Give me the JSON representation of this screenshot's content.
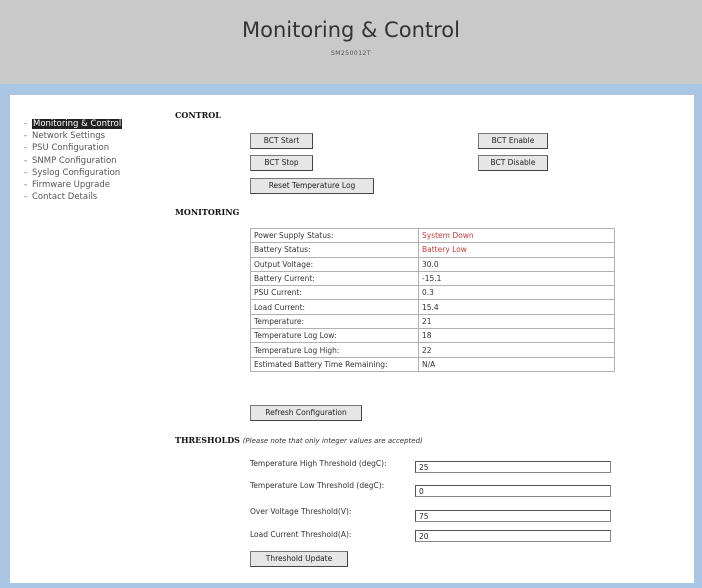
{
  "header": {
    "title": "Monitoring & Control",
    "subtitle": "SM250012T"
  },
  "nav": {
    "items": [
      {
        "label": "Monitoring & Control",
        "active": true
      },
      {
        "label": "Network Settings"
      },
      {
        "label": "PSU Configuration"
      },
      {
        "label": "SNMP Configuration"
      },
      {
        "label": "Syslog Configuration"
      },
      {
        "label": "Firmware Upgrade"
      },
      {
        "label": "Contact Details"
      }
    ]
  },
  "control": {
    "heading": "CONTROL",
    "bct_start": "BCT Start",
    "bct_stop": "BCT Stop",
    "bct_enable": "BCT Enable",
    "bct_disable": "BCT Disable",
    "reset_temp_log": "Reset Temperature Log"
  },
  "monitoring": {
    "heading": "MONITORING",
    "rows": [
      {
        "label": "Power Supply Status:",
        "value": "System Down",
        "alert": true
      },
      {
        "label": "Battery Status:",
        "value": "Battery Low",
        "alert": true
      },
      {
        "label": "Output Voltage:",
        "value": "30.0"
      },
      {
        "label": "Battery Current:",
        "value": "-15.1"
      },
      {
        "label": "PSU Current:",
        "value": "0.3"
      },
      {
        "label": "Load Current:",
        "value": "15.4"
      },
      {
        "label": "Temperature:",
        "value": "21"
      },
      {
        "label": "Temperature Log Low:",
        "value": "18"
      },
      {
        "label": "Temperature Log High:",
        "value": "22"
      },
      {
        "label": "Estimated Battery Time Remaining:",
        "value": "N/A"
      }
    ],
    "refresh_button": "Refresh Configuration"
  },
  "thresholds": {
    "heading": "THRESHOLDS",
    "note": "(Please note that only integer values are accepted)",
    "fields": [
      {
        "label": "Temperature High Threshold (degC):",
        "value": "25"
      },
      {
        "label": "Temperature Low Threshold (degC):",
        "value": "0"
      },
      {
        "label": "Over Voltage Threshold(V):",
        "value": "75"
      },
      {
        "label": "Load Current Threshold(A):",
        "value": "20"
      }
    ],
    "update_button": "Threshold Update"
  },
  "colors": {
    "header_bg": "#c9c9c9",
    "band": "#a9c7e4",
    "alert_text": "#c43a3a",
    "active_nav_bg": "#222222"
  }
}
